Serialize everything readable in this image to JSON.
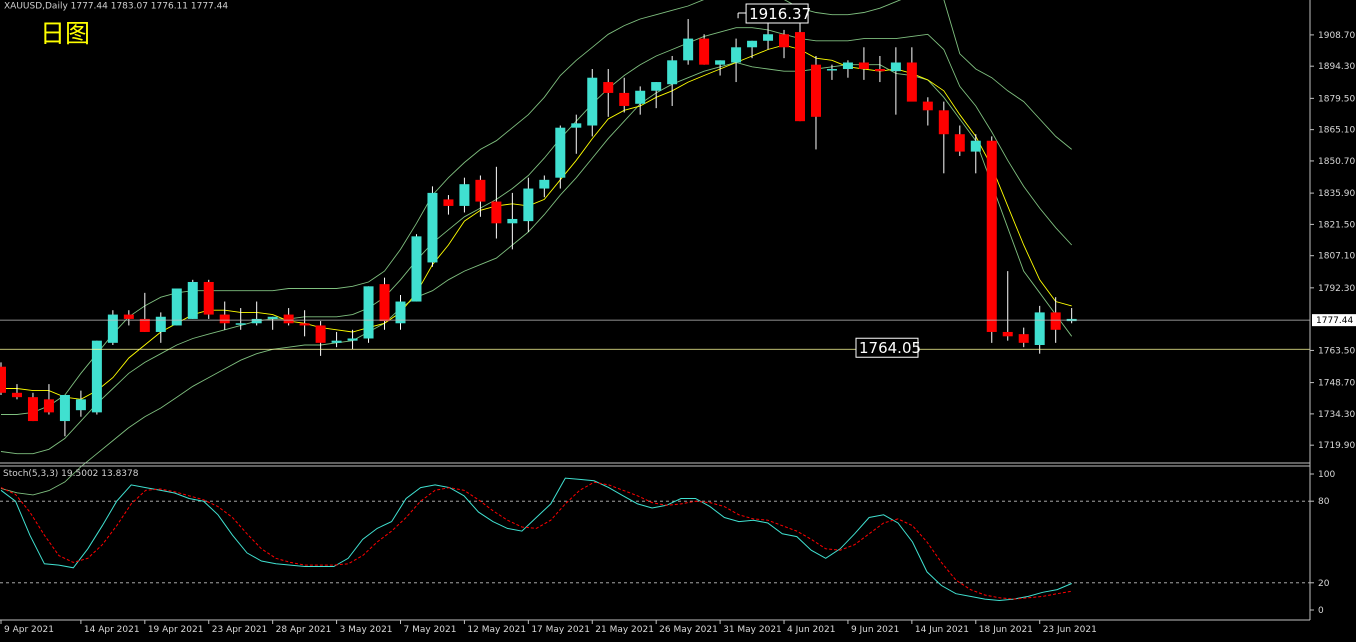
{
  "chart_data": [
    {
      "type": "candlestick",
      "header": "XAUUSD,Daily  1777.44 1783.07 1776.11 1777.44",
      "caption": "日图",
      "colors": {
        "bull": "#40e0d0",
        "bear": "#ff0000",
        "ma": "#ffff00",
        "bands": "#7fbf7f",
        "hline": "#c0c0c0",
        "support": "#ffff99",
        "stroke": "#ffffff"
      },
      "ylim": [
        1714,
        1922
      ],
      "y_ticks": [
        "1908.70",
        "1894.30",
        "1879.50",
        "1865.10",
        "1850.70",
        "1835.90",
        "1821.50",
        "1807.10",
        "1792.30",
        "1777.44",
        "1763.50",
        "1748.70",
        "1734.30",
        "1719.90"
      ],
      "current_price_label": "1777.44",
      "high_annotation": {
        "label": "1916.37",
        "value": 1916.37,
        "index": 46
      },
      "support_annotation": {
        "label": "1764.05",
        "value": 1764.05
      },
      "dates": [
        "9 Apr 2021",
        "14 Apr 2021",
        "19 Apr 2021",
        "23 Apr 2021",
        "28 Apr 2021",
        "3 May 2021",
        "7 May 2021",
        "12 May 2021",
        "17 May 2021",
        "21 May 2021",
        "26 May 2021",
        "31 May 2021",
        "4 Jun 2021",
        "9 Jun 2021",
        "14 Jun 2021",
        "18 Jun 2021",
        "23 Jun 2021"
      ],
      "date_index": [
        0,
        5,
        9,
        13,
        17,
        21,
        25,
        29,
        33,
        37,
        41,
        45,
        49,
        53,
        57,
        61,
        65
      ],
      "candles": [
        [
          1756,
          1758,
          1743,
          1744
        ],
        [
          1744,
          1748,
          1741,
          1742
        ],
        [
          1742,
          1744,
          1731,
          1731
        ],
        [
          1741,
          1748,
          1734,
          1735
        ],
        [
          1731,
          1743,
          1724,
          1743
        ],
        [
          1736,
          1745,
          1733,
          1741
        ],
        [
          1735,
          1768,
          1734,
          1768
        ],
        [
          1767,
          1782,
          1766,
          1780
        ],
        [
          1780,
          1782,
          1775,
          1778
        ],
        [
          1778,
          1790,
          1772,
          1772
        ],
        [
          1772,
          1781,
          1767,
          1779
        ],
        [
          1775,
          1792,
          1775,
          1792
        ],
        [
          1778,
          1796,
          1778,
          1795
        ],
        [
          1795,
          1796,
          1778,
          1780
        ],
        [
          1780,
          1786,
          1773,
          1776
        ],
        [
          1776,
          1783,
          1773,
          1776
        ],
        [
          1776,
          1786,
          1775,
          1778
        ],
        [
          1778,
          1779,
          1773,
          1779
        ],
        [
          1780,
          1783,
          1775,
          1776
        ],
        [
          1776,
          1782,
          1770,
          1775
        ],
        [
          1775,
          1777,
          1761,
          1767
        ],
        [
          1767,
          1772,
          1765,
          1768
        ],
        [
          1768,
          1773,
          1764,
          1769
        ],
        [
          1769,
          1793,
          1767,
          1793
        ],
        [
          1794,
          1797,
          1773,
          1777
        ],
        [
          1776,
          1789,
          1773,
          1786
        ],
        [
          1786,
          1817,
          1786,
          1816
        ],
        [
          1804,
          1839,
          1802,
          1836
        ],
        [
          1833,
          1835,
          1826,
          1830
        ],
        [
          1830,
          1843,
          1827,
          1840
        ],
        [
          1842,
          1844,
          1825,
          1832
        ],
        [
          1832,
          1848,
          1815,
          1822
        ],
        [
          1822,
          1836,
          1810,
          1824
        ],
        [
          1823,
          1843,
          1818,
          1838
        ],
        [
          1838,
          1844,
          1834,
          1842
        ],
        [
          1843,
          1867,
          1838,
          1866
        ],
        [
          1866,
          1872,
          1854,
          1868
        ],
        [
          1867,
          1893,
          1862,
          1889
        ],
        [
          1887,
          1893,
          1871,
          1882
        ],
        [
          1882,
          1889,
          1873,
          1876
        ],
        [
          1877,
          1885,
          1872,
          1883
        ],
        [
          1883,
          1887,
          1875,
          1887
        ],
        [
          1886,
          1899,
          1876,
          1897
        ],
        [
          1897,
          1916,
          1895,
          1907
        ],
        [
          1907,
          1909,
          1895,
          1895
        ],
        [
          1895,
          1897,
          1890,
          1897
        ],
        [
          1896,
          1907,
          1887,
          1903
        ],
        [
          1903,
          1906,
          1898,
          1906
        ],
        [
          1906,
          1916,
          1902,
          1909
        ],
        [
          1909,
          1911,
          1898,
          1903
        ],
        [
          1910,
          1916,
          1869,
          1869
        ],
        [
          1895,
          1899,
          1856,
          1871
        ],
        [
          1893,
          1895,
          1888,
          1893
        ],
        [
          1893,
          1897,
          1889,
          1896
        ],
        [
          1896,
          1903,
          1888,
          1893
        ],
        [
          1893,
          1899,
          1887,
          1892
        ],
        [
          1892,
          1903,
          1872,
          1896
        ],
        [
          1896,
          1903,
          1879,
          1878
        ],
        [
          1878,
          1880,
          1867,
          1874
        ],
        [
          1874,
          1878,
          1845,
          1863
        ],
        [
          1863,
          1867,
          1853,
          1855
        ],
        [
          1855,
          1863,
          1845,
          1860
        ],
        [
          1860,
          1862,
          1767,
          1772
        ],
        [
          1772,
          1800,
          1768,
          1770
        ],
        [
          1771,
          1774,
          1765,
          1767
        ],
        [
          1766,
          1784,
          1762,
          1781
        ],
        [
          1781,
          1788,
          1767,
          1773
        ],
        [
          1777,
          1783,
          1776,
          1778
        ]
      ],
      "ma": [
        1746,
        1746,
        1745,
        1745,
        1742,
        1741,
        1745,
        1751,
        1760,
        1766,
        1772,
        1776,
        1780,
        1782,
        1782,
        1781,
        1781,
        1780,
        1777,
        1776,
        1774,
        1773,
        1772,
        1774,
        1776,
        1781,
        1790,
        1803,
        1812,
        1823,
        1828,
        1830,
        1831,
        1830,
        1833,
        1842,
        1851,
        1861,
        1870,
        1874,
        1876,
        1880,
        1883,
        1887,
        1890,
        1893,
        1896,
        1899,
        1902,
        1904,
        1902,
        1898,
        1897,
        1894,
        1893,
        1892,
        1893,
        1891,
        1888,
        1883,
        1872,
        1862,
        1848,
        1830,
        1812,
        1796,
        1786,
        1784
      ],
      "upper_band": [
        1734,
        1734,
        1735,
        1738,
        1743,
        1753,
        1762,
        1771,
        1779,
        1784,
        1788,
        1790,
        1791,
        1791,
        1791,
        1791,
        1791,
        1791,
        1792,
        1792,
        1792,
        1792,
        1793,
        1795,
        1800,
        1810,
        1822,
        1835,
        1843,
        1850,
        1856,
        1860,
        1866,
        1872,
        1880,
        1890,
        1897,
        1903,
        1909,
        1913,
        1916,
        1918,
        1920,
        1922,
        1925,
        1928,
        1931,
        1930,
        1928,
        1925,
        1921,
        1919,
        1918,
        1918,
        1919,
        1921,
        1924,
        1927,
        1932,
        1925,
        1900,
        1893,
        1889,
        1883,
        1878,
        1870,
        1862,
        1856
      ],
      "lower_band": [
        1700,
        1698,
        1697,
        1699,
        1703,
        1710,
        1716,
        1722,
        1728,
        1733,
        1737,
        1742,
        1747,
        1751,
        1755,
        1759,
        1762,
        1764,
        1765,
        1766,
        1766,
        1767,
        1768,
        1772,
        1776,
        1783,
        1788,
        1791,
        1796,
        1800,
        1803,
        1806,
        1812,
        1818,
        1826,
        1835,
        1843,
        1852,
        1861,
        1869,
        1877,
        1882,
        1886,
        1889,
        1892,
        1894,
        1896,
        1894,
        1893,
        1892,
        1892,
        1893,
        1894,
        1895,
        1895,
        1895,
        1891,
        1890,
        1888,
        1880,
        1870,
        1860,
        1840,
        1820,
        1800,
        1790,
        1780,
        1770
      ],
      "mid_band": [
        1717,
        1716,
        1716,
        1718,
        1723,
        1731,
        1739,
        1746,
        1753,
        1758,
        1762,
        1766,
        1769,
        1771,
        1773,
        1775,
        1777,
        1778,
        1778,
        1779,
        1779,
        1779,
        1780,
        1783,
        1788,
        1796,
        1805,
        1813,
        1819,
        1825,
        1829,
        1833,
        1838,
        1844,
        1852,
        1861,
        1869,
        1877,
        1884,
        1890,
        1895,
        1899,
        1902,
        1905,
        1908,
        1910,
        1912,
        1912,
        1911,
        1909,
        1907,
        1906,
        1906,
        1906,
        1907,
        1907,
        1907,
        1908,
        1909,
        1902,
        1885,
        1876,
        1864,
        1851,
        1839,
        1829,
        1820,
        1812
      ]
    },
    {
      "type": "line",
      "header": "Stoch(5,3,3) 19.5002 13.8378",
      "ylim": [
        0,
        100
      ],
      "y_ticks": [
        "100",
        "80",
        "20",
        "0"
      ],
      "levels": [
        80,
        20
      ],
      "colors": {
        "main": "#40e0d0",
        "signal": "#ff0000",
        "level": "#c0c0c0"
      },
      "series": [
        {
          "name": "Stoch",
          "values": [
            88,
            80,
            55,
            34,
            33,
            31,
            45,
            62,
            80,
            92,
            90,
            88,
            86,
            82,
            80,
            70,
            55,
            42,
            36,
            34,
            33,
            32,
            32,
            32,
            38,
            52,
            60,
            65,
            82,
            90,
            92,
            90,
            84,
            72,
            65,
            60,
            58,
            68,
            78,
            97,
            96,
            95,
            90,
            84,
            78,
            75,
            77,
            82,
            82,
            76,
            68,
            65,
            66,
            64,
            56,
            54,
            44,
            38,
            45,
            56,
            68,
            70,
            64,
            50,
            28,
            18,
            12,
            10,
            8,
            7,
            8,
            10,
            13,
            15,
            19.5
          ]
        },
        {
          "name": "Signal",
          "values": [
            90,
            85,
            72,
            55,
            40,
            35,
            38,
            48,
            62,
            78,
            88,
            89,
            87,
            84,
            81,
            76,
            68,
            56,
            45,
            38,
            35,
            33,
            33,
            33,
            34,
            40,
            50,
            58,
            68,
            80,
            88,
            90,
            88,
            81,
            73,
            66,
            61,
            60,
            66,
            78,
            88,
            94,
            92,
            88,
            84,
            79,
            77,
            78,
            80,
            79,
            76,
            70,
            67,
            66,
            62,
            58,
            52,
            45,
            44,
            48,
            56,
            64,
            67,
            62,
            50,
            35,
            22,
            15,
            11,
            9,
            8,
            9,
            10,
            12,
            13.8
          ]
        }
      ],
      "x_len": 68
    }
  ]
}
